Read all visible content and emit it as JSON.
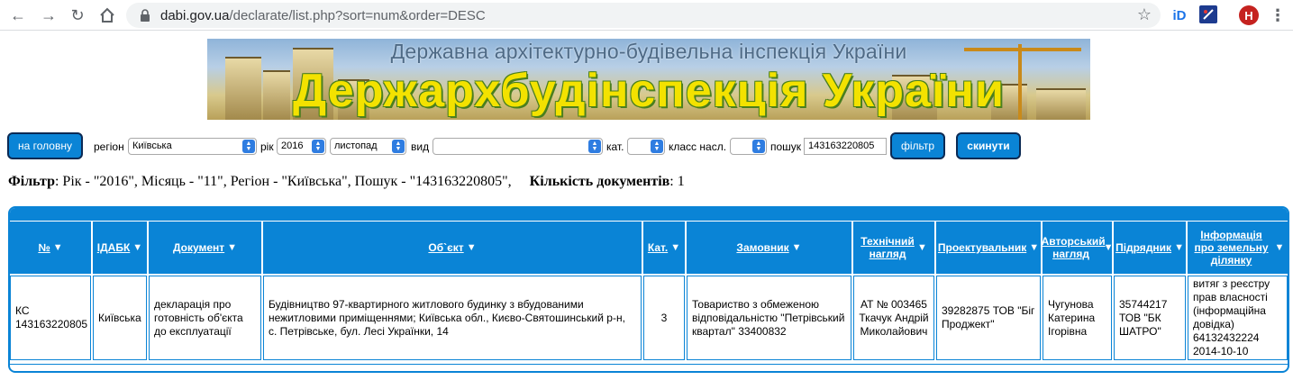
{
  "browser": {
    "url_host": "dabi.gov.ua",
    "url_path": "/declarate/list.php?sort=num&order=DESC",
    "ext_id_label": "iD",
    "avatar_letter": "H"
  },
  "banner": {
    "subtitle": "Державна архітектурно-будівельна інспекція України",
    "title": "Держархбудінспекція України"
  },
  "filters": {
    "home_button": "на головну",
    "region_label": "регіон",
    "region_value": "Київська",
    "year_label": "рік",
    "year_value": "2016",
    "month_value": "листопад",
    "type_label": "вид",
    "type_value": "",
    "cat_label": "кат.",
    "cat_value": "",
    "class_label": "класс насл.",
    "class_value": "",
    "search_label": "пошук",
    "search_value": "143163220805",
    "filter_button": "фільтр",
    "reset_button": "скинути"
  },
  "summary": {
    "filter_label": "Фільтр",
    "filter_text": ": Рік - \"2016\", Місяць - \"11\", Регіон - \"Київська\", Пошук - \"143163220805\",",
    "count_label": "Кількість документів",
    "count_value": ": 1"
  },
  "table": {
    "headers": [
      "№",
      "ІДАБК",
      "Документ",
      "Об`єкт",
      "Кат.",
      "Замовник",
      "Технічний нагляд",
      "Проектувальник",
      "Авторський нагляд",
      "Підрядник",
      "Інформація про земельну ділянку"
    ],
    "rows": [
      [
        "КС 143163220805",
        "Київська",
        "декларація про готовність об'єкта до експлуатації",
        "Будівництво 97-квартирного житлового будинку з вбудованими нежитловими приміщеннями; Київська обл., Києво-Святошинський р-н, с. Петрівське, бул. Лесі Українки, 14",
        "3",
        "Товариство з обмеженою відповідальністю \"Петрівський квартал\" 33400832",
        "АТ № 003465 Ткачук Андрій Миколайович",
        "39282875 ТОВ \"Біг Проджект\"",
        "Чугунова Катерина Ігорівна",
        "35744217 ТОВ \"БК ШАТРО\"",
        "витяг з реєстру прав власності (інформаційна довідка) 64132432224 2014-10-10"
      ]
    ]
  },
  "colors": {
    "accent": "#0a84d6",
    "button_border": "#0b2a54",
    "banner_title": "#f3e200"
  }
}
